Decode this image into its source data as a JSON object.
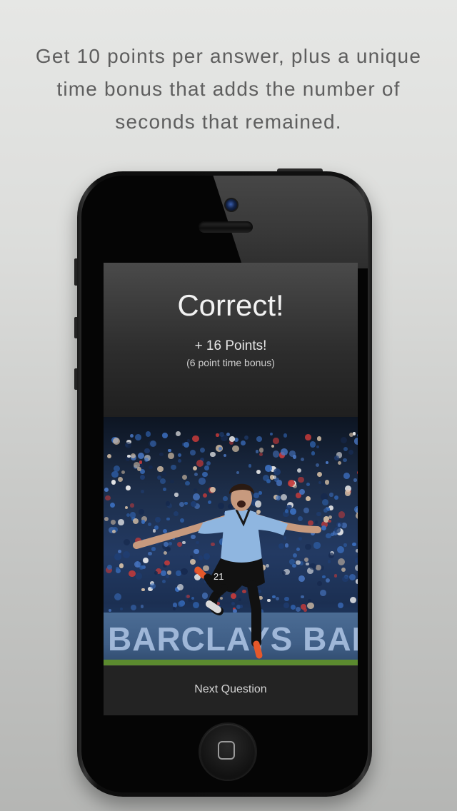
{
  "promo": {
    "line1": "Get 10 points per answer, plus a unique",
    "line2": "time bonus that adds the number of",
    "line3": "seconds that remained."
  },
  "result": {
    "title": "Correct!",
    "points": "+ 16 Points!",
    "bonus": "(6 point time bonus)"
  },
  "photo": {
    "board_text": "BARCLAYS  BAR",
    "shirt_number": "21"
  },
  "actions": {
    "next_question": "Next Question"
  }
}
